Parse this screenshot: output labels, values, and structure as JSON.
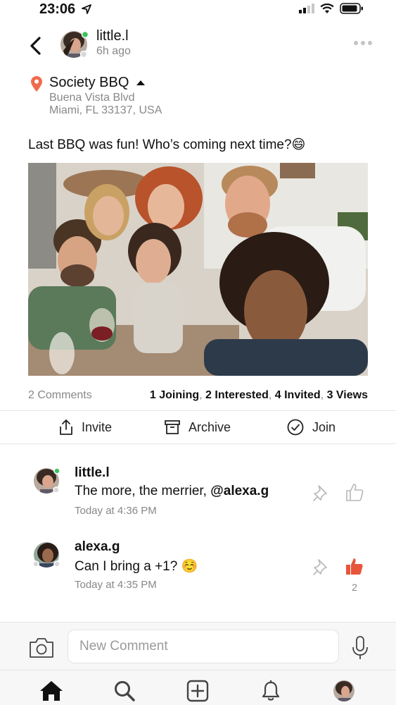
{
  "status_bar": {
    "time": "23:06"
  },
  "header": {
    "username": "little.l",
    "time_ago": "6h ago"
  },
  "location": {
    "name": "Society BBQ",
    "address_line1": "Buena Vista Blvd",
    "address_line2": "Miami, FL 33137, USA"
  },
  "post": {
    "text": "Last BBQ was fun! Who’s coming next time?😄"
  },
  "stats": {
    "comments": "2 Comments",
    "joining": "1 Joining",
    "interested": "2 Interested",
    "invited": "4 Invited",
    "views": "3 Views",
    "separator": ","
  },
  "actions": {
    "invite": "Invite",
    "archive": "Archive",
    "join": "Join"
  },
  "comments": [
    {
      "username": "little.l",
      "text_prefix": "The more, the merrier, ",
      "mention": "@alexa.g",
      "time": "Today at 4:36 PM",
      "liked": false,
      "like_count": ""
    },
    {
      "username": "alexa.g",
      "text_prefix": "Can I bring a +1? ☺️",
      "mention": "",
      "time": "Today at 4:35 PM",
      "liked": true,
      "like_count": "2"
    }
  ],
  "composer": {
    "placeholder": "New Comment"
  },
  "tabs": [
    "home-icon",
    "search-icon",
    "add-icon",
    "bell-icon",
    "profile-avatar"
  ],
  "colors": {
    "accent_like": "#e8553b",
    "pin": "#ef6a4c",
    "online": "#3cc35a",
    "muted": "#888888"
  }
}
